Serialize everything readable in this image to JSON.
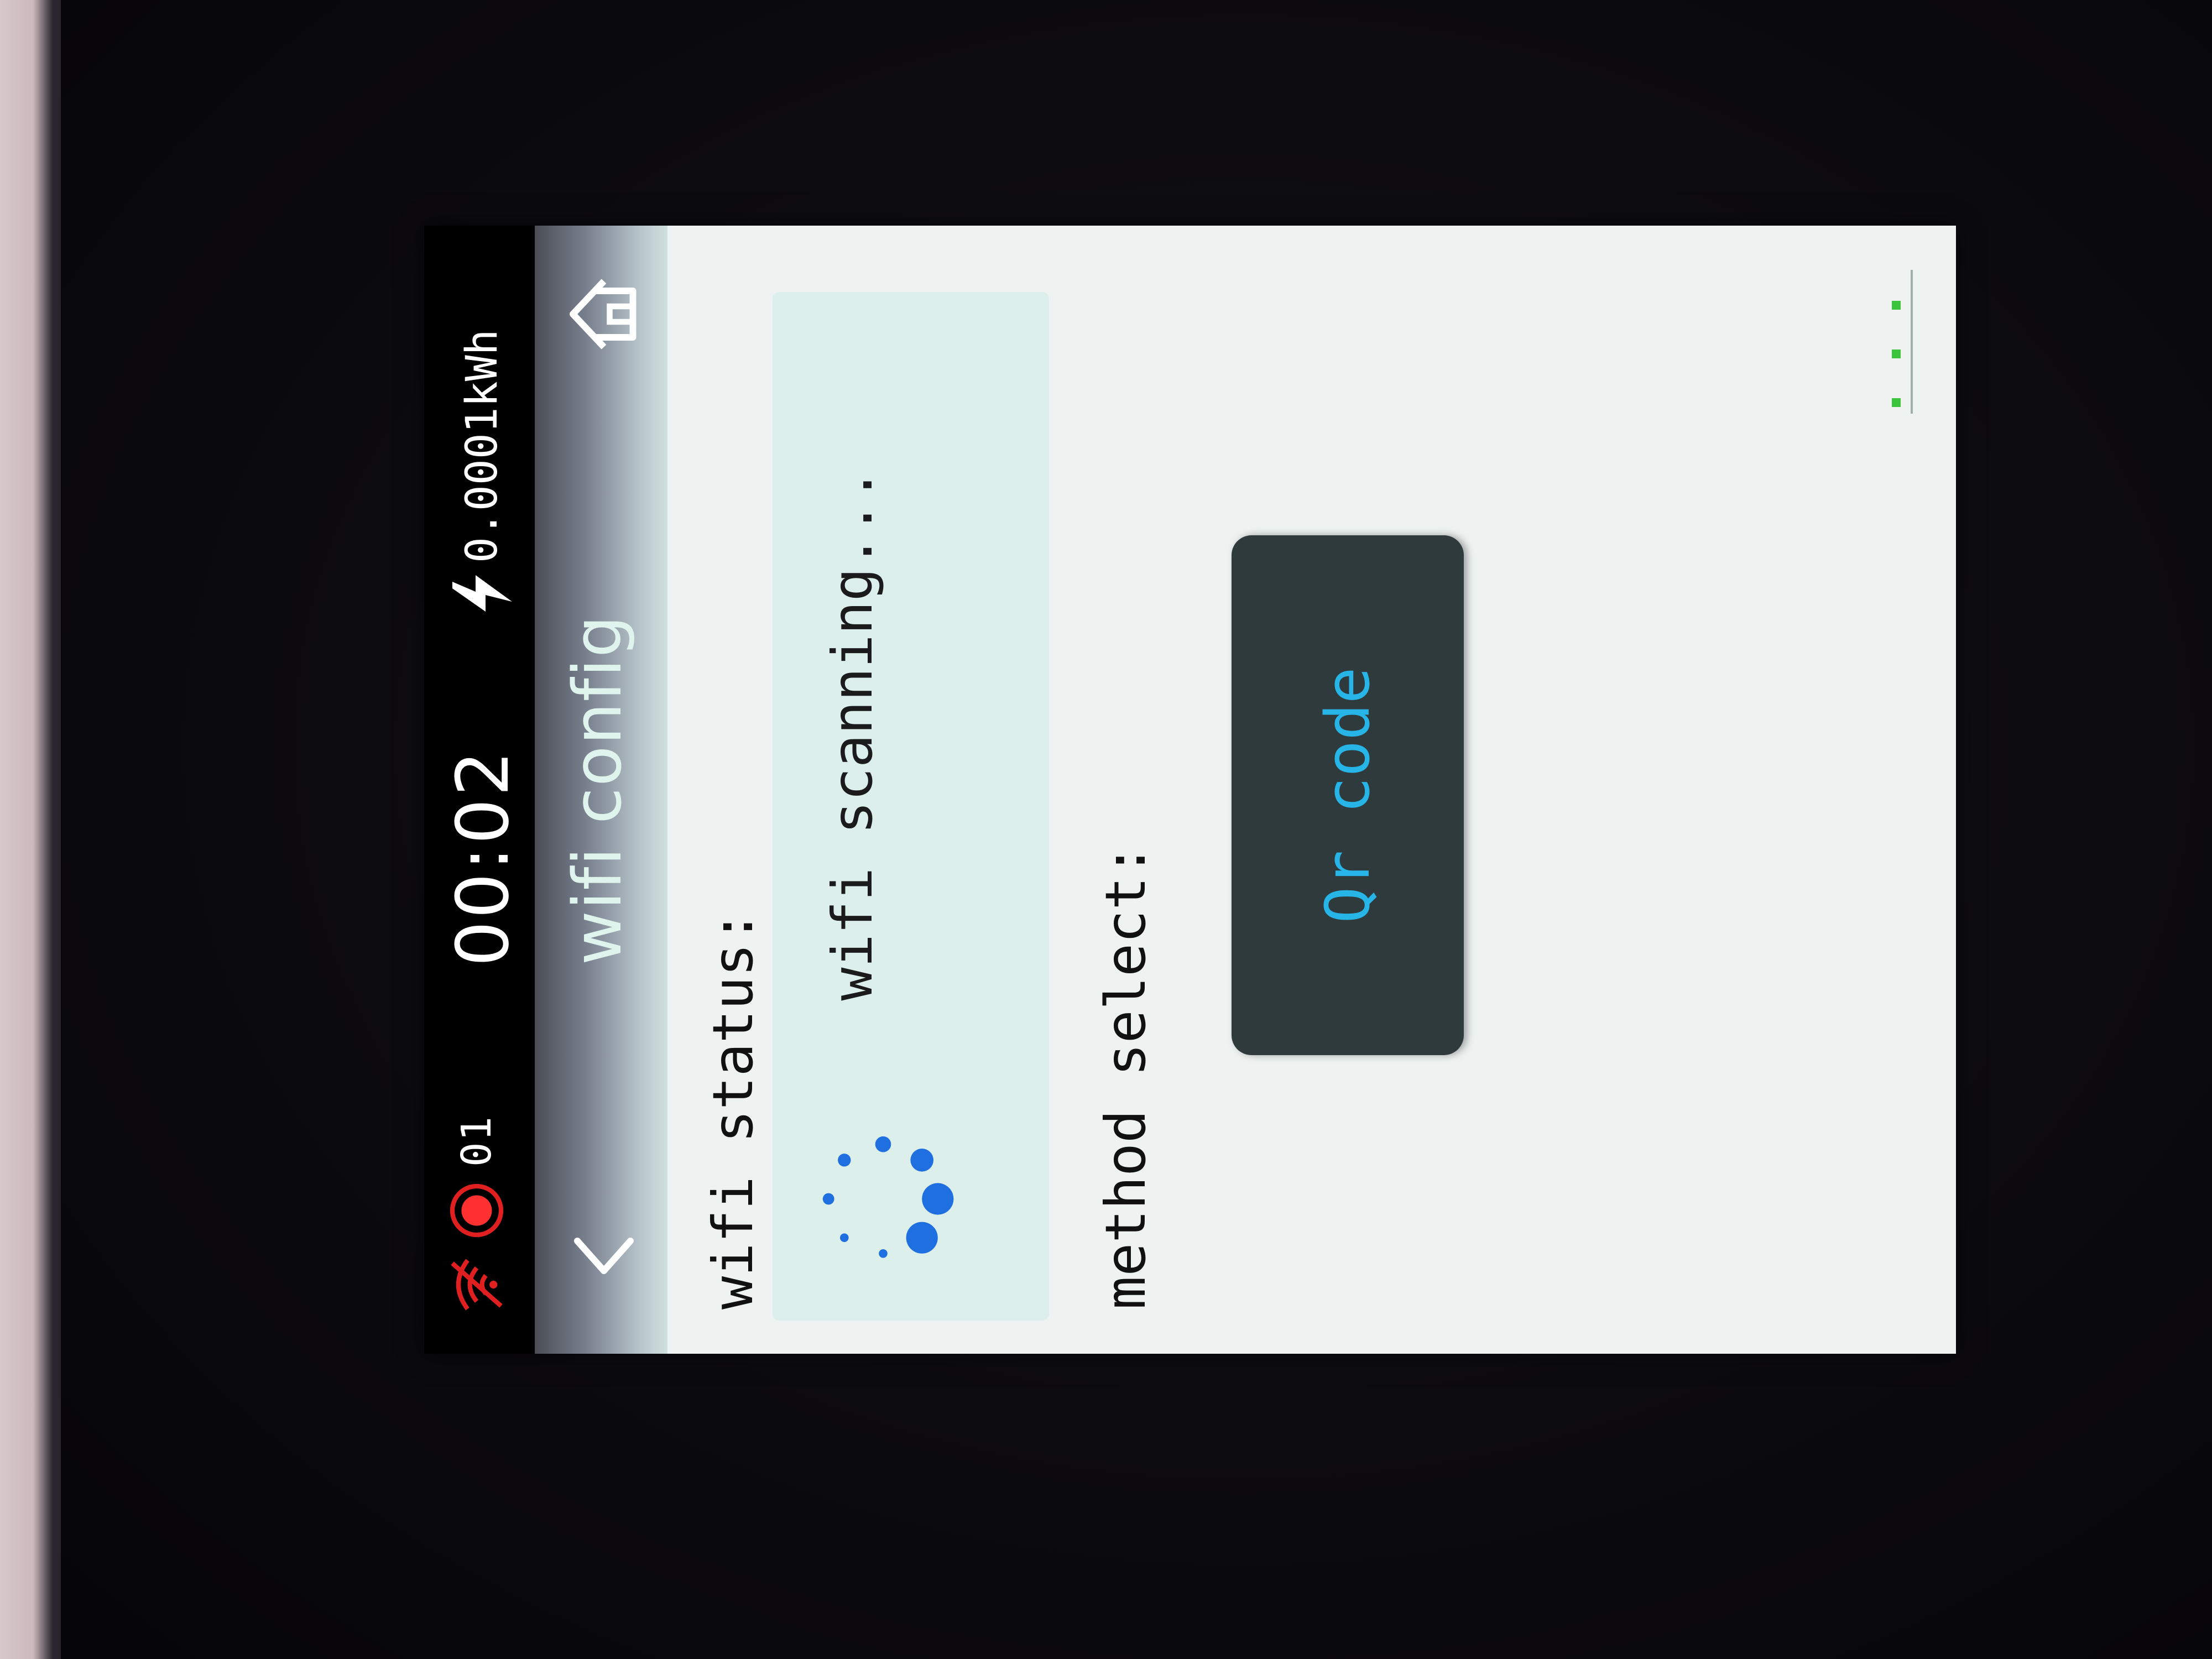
{
  "status_bar": {
    "wifi_icon": "wifi-off-icon",
    "record_icon": "record-icon",
    "record_count": "01",
    "time": "00:02",
    "energy_icon": "lightning-bolt-icon",
    "energy_value": "0.0001kWh"
  },
  "title_bar": {
    "back_icon": "chevron-left-icon",
    "title": "wifi config",
    "home_icon": "home-icon"
  },
  "content": {
    "wifi_status_label": "wifi status:",
    "status_text": "wifi scanning...",
    "spinner_icon": "loading-spinner-icon",
    "method_label": "method select:",
    "qr_button_label": "Qr code"
  },
  "colors": {
    "screen_bg": "#eef3f1",
    "status_panel_bg": "#dcefea",
    "spinner_blue": "#1f6fe0",
    "button_bg": "#2f3a3d",
    "button_text": "#27b5e8",
    "wifi_off_red": "#e02020",
    "indicator_green": "#3cc43c"
  }
}
